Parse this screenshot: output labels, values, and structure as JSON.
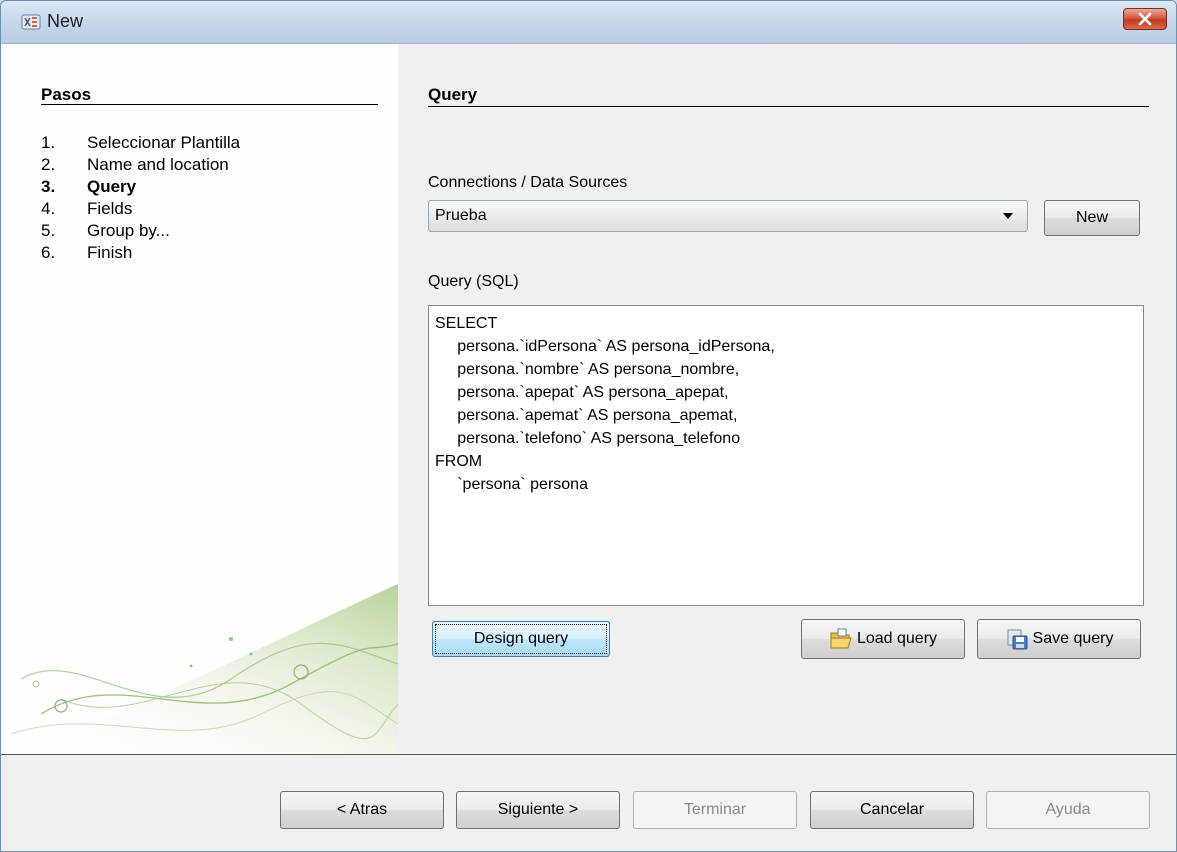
{
  "window": {
    "title": "New"
  },
  "steps": {
    "title": "Pasos",
    "items": [
      {
        "num": "1.",
        "label": "Seleccionar Plantilla",
        "current": false
      },
      {
        "num": "2.",
        "label": "Name and location",
        "current": false
      },
      {
        "num": "3.",
        "label": "Query",
        "current": true
      },
      {
        "num": "4.",
        "label": "Fields",
        "current": false
      },
      {
        "num": "5.",
        "label": "Group by...",
        "current": false
      },
      {
        "num": "6.",
        "label": "Finish",
        "current": false
      }
    ]
  },
  "query_page": {
    "title": "Query",
    "connections_label": "Connections / Data Sources",
    "connection_selected": "Prueba",
    "new_button": "New",
    "sql_label": "Query (SQL)",
    "sql_text": "SELECT\n     persona.`idPersona` AS persona_idPersona,\n     persona.`nombre` AS persona_nombre,\n     persona.`apepat` AS persona_apepat,\n     persona.`apemat` AS persona_apemat,\n     persona.`telefono` AS persona_telefono\nFROM\n     `persona` persona",
    "design_query_button": "Design query",
    "load_query_button": "Load query",
    "save_query_button": "Save query"
  },
  "footer": {
    "back_button": "< Atras",
    "next_button": "Siguiente >",
    "finish_button": "Terminar",
    "cancel_button": "Cancelar",
    "help_button": "Ayuda"
  },
  "colors": {
    "close_button": "#c23a1d",
    "titlebar": "#c6d7ea",
    "focus_button": "#bee6fd"
  }
}
